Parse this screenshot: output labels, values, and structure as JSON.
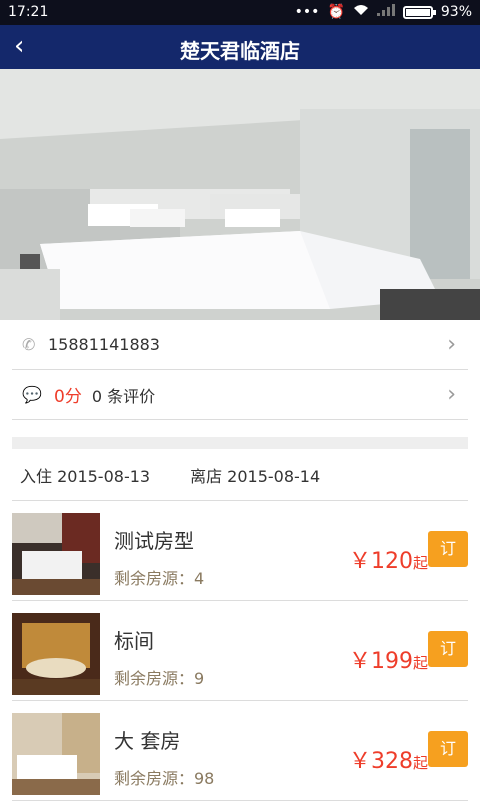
{
  "status_bar": {
    "time": "17:21",
    "battery": "93%",
    "battery_level": 0.93
  },
  "nav": {
    "title": "楚天君临酒店"
  },
  "contact": {
    "phone": "15881141883",
    "score": "0分",
    "reviews": "0 条评价"
  },
  "dates": {
    "checkin": "入住 2015-08-13",
    "checkout": "离店 2015-08-14"
  },
  "rooms": [
    {
      "name": "测试房型",
      "availability": "剩余房源：4",
      "price": "￥120",
      "suffix": "起",
      "book": "订"
    },
    {
      "name": "标间",
      "availability": "剩余房源：9",
      "price": "￥199",
      "suffix": "起",
      "book": "订"
    },
    {
      "name": "大 套房",
      "availability": "剩余房源：98",
      "price": "￥328",
      "suffix": "起",
      "book": "订"
    }
  ],
  "colors": {
    "nav": "#14286b",
    "accent_red": "#ee3d2a",
    "book_orange": "#f6a01f"
  }
}
